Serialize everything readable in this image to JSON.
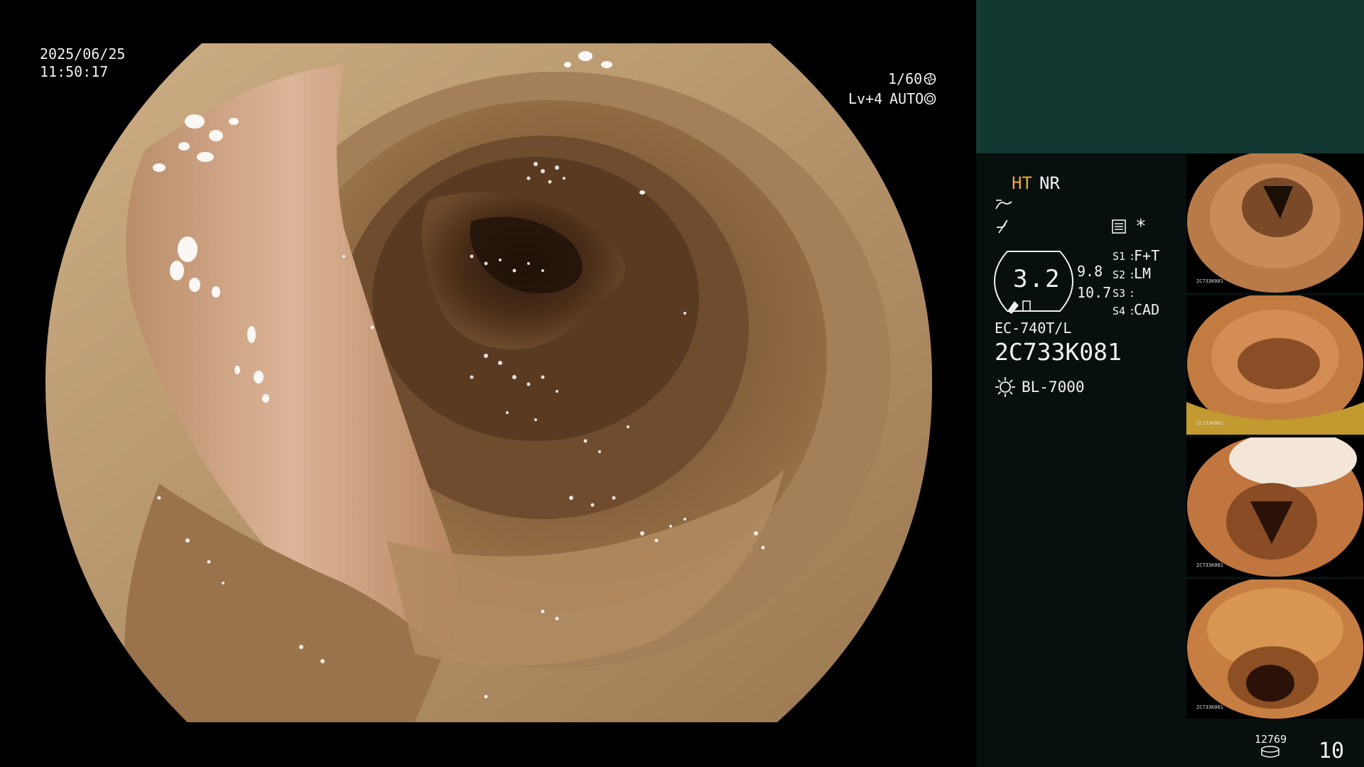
{
  "overlay": {
    "date": "2025/06/25",
    "time": "11:50:17",
    "shutter": "1/60",
    "iris_level": "Lv+4",
    "iris_mode": "AUTO"
  },
  "side": {
    "ht": "HT",
    "nr": "NR",
    "magnification": "3.2",
    "value_a": "9.8",
    "value_b": "10.7",
    "switches": [
      {
        "key": "S1",
        "val": "F+T"
      },
      {
        "key": "S2",
        "val": "LM"
      },
      {
        "key": "S3",
        "val": ""
      },
      {
        "key": "S4",
        "val": "CAD"
      }
    ],
    "scope_model": "EC-740T/L",
    "serial": "2C733K081",
    "light_source": "BL-7000",
    "asterisk": "*",
    "counter": "12769",
    "image_count": "10"
  },
  "thumbnails": [
    {
      "serial": "2C733K081"
    },
    {
      "serial": "2C733K081"
    },
    {
      "serial": "2C733K081"
    },
    {
      "serial": "2C733K081"
    }
  ],
  "colors": {
    "ht_accent": "#f0a830",
    "panel_top": "#123832",
    "panel_bottom": "#07100f",
    "mucosa": "#a97b4f"
  },
  "icons": [
    "shutter-icon",
    "auto-iris-icon",
    "enhance-curve-icon",
    "filter-icon",
    "memory-card-icon",
    "light-source-icon",
    "storage-icon"
  ]
}
